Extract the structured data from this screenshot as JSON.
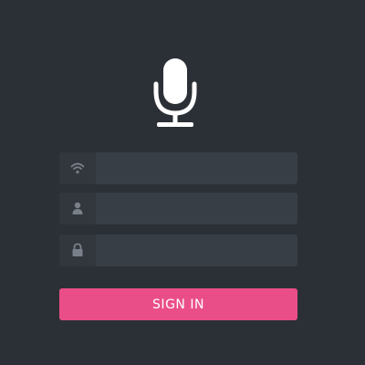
{
  "app": {
    "logo_icon": "microphone-icon"
  },
  "form": {
    "fields": [
      {
        "icon": "wifi-icon",
        "value": "",
        "placeholder": ""
      },
      {
        "icon": "user-icon",
        "value": "",
        "placeholder": ""
      },
      {
        "icon": "lock-icon",
        "value": "",
        "placeholder": ""
      }
    ],
    "sign_in_label": "SIGN IN"
  },
  "colors": {
    "background": "#2b3036",
    "field_background": "#383e46",
    "icon_box_background": "#32373e",
    "icon_color": "#7a8089",
    "accent": "#ea4e88",
    "logo_color": "#ffffff"
  }
}
